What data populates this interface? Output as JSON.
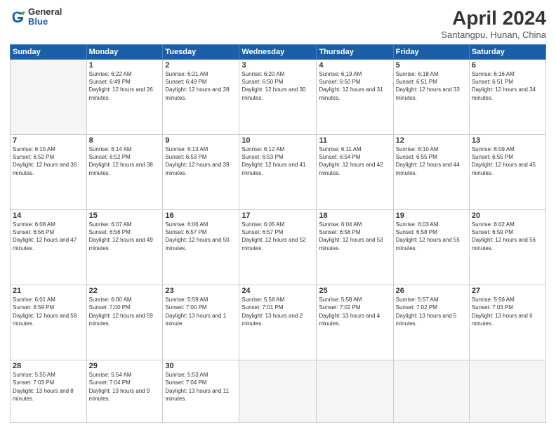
{
  "logo": {
    "general": "General",
    "blue": "Blue"
  },
  "title": "April 2024",
  "location": "Santangpu, Hunan, China",
  "days_of_week": [
    "Sunday",
    "Monday",
    "Tuesday",
    "Wednesday",
    "Thursday",
    "Friday",
    "Saturday"
  ],
  "weeks": [
    [
      {
        "day": "",
        "empty": true
      },
      {
        "day": "1",
        "sunrise": "6:22 AM",
        "sunset": "6:49 PM",
        "daylight": "12 hours and 26 minutes."
      },
      {
        "day": "2",
        "sunrise": "6:21 AM",
        "sunset": "6:49 PM",
        "daylight": "12 hours and 28 minutes."
      },
      {
        "day": "3",
        "sunrise": "6:20 AM",
        "sunset": "6:50 PM",
        "daylight": "12 hours and 30 minutes."
      },
      {
        "day": "4",
        "sunrise": "6:19 AM",
        "sunset": "6:50 PM",
        "daylight": "12 hours and 31 minutes."
      },
      {
        "day": "5",
        "sunrise": "6:18 AM",
        "sunset": "6:51 PM",
        "daylight": "12 hours and 33 minutes."
      },
      {
        "day": "6",
        "sunrise": "6:16 AM",
        "sunset": "6:51 PM",
        "daylight": "12 hours and 34 minutes."
      }
    ],
    [
      {
        "day": "7",
        "sunrise": "6:15 AM",
        "sunset": "6:52 PM",
        "daylight": "12 hours and 36 minutes."
      },
      {
        "day": "8",
        "sunrise": "6:14 AM",
        "sunset": "6:52 PM",
        "daylight": "12 hours and 38 minutes."
      },
      {
        "day": "9",
        "sunrise": "6:13 AM",
        "sunset": "6:53 PM",
        "daylight": "12 hours and 39 minutes."
      },
      {
        "day": "10",
        "sunrise": "6:12 AM",
        "sunset": "6:53 PM",
        "daylight": "12 hours and 41 minutes."
      },
      {
        "day": "11",
        "sunrise": "6:11 AM",
        "sunset": "6:54 PM",
        "daylight": "12 hours and 42 minutes."
      },
      {
        "day": "12",
        "sunrise": "6:10 AM",
        "sunset": "6:55 PM",
        "daylight": "12 hours and 44 minutes."
      },
      {
        "day": "13",
        "sunrise": "6:09 AM",
        "sunset": "6:55 PM",
        "daylight": "12 hours and 45 minutes."
      }
    ],
    [
      {
        "day": "14",
        "sunrise": "6:08 AM",
        "sunset": "6:56 PM",
        "daylight": "12 hours and 47 minutes."
      },
      {
        "day": "15",
        "sunrise": "6:07 AM",
        "sunset": "6:56 PM",
        "daylight": "12 hours and 49 minutes."
      },
      {
        "day": "16",
        "sunrise": "6:06 AM",
        "sunset": "6:57 PM",
        "daylight": "12 hours and 50 minutes."
      },
      {
        "day": "17",
        "sunrise": "6:05 AM",
        "sunset": "6:57 PM",
        "daylight": "12 hours and 52 minutes."
      },
      {
        "day": "18",
        "sunrise": "6:04 AM",
        "sunset": "6:58 PM",
        "daylight": "12 hours and 53 minutes."
      },
      {
        "day": "19",
        "sunrise": "6:03 AM",
        "sunset": "6:58 PM",
        "daylight": "12 hours and 55 minutes."
      },
      {
        "day": "20",
        "sunrise": "6:02 AM",
        "sunset": "6:59 PM",
        "daylight": "12 hours and 56 minutes."
      }
    ],
    [
      {
        "day": "21",
        "sunrise": "6:01 AM",
        "sunset": "6:59 PM",
        "daylight": "12 hours and 58 minutes."
      },
      {
        "day": "22",
        "sunrise": "6:00 AM",
        "sunset": "7:00 PM",
        "daylight": "12 hours and 59 minutes."
      },
      {
        "day": "23",
        "sunrise": "5:59 AM",
        "sunset": "7:00 PM",
        "daylight": "13 hours and 1 minute."
      },
      {
        "day": "24",
        "sunrise": "5:58 AM",
        "sunset": "7:01 PM",
        "daylight": "13 hours and 2 minutes."
      },
      {
        "day": "25",
        "sunrise": "5:58 AM",
        "sunset": "7:02 PM",
        "daylight": "13 hours and 4 minutes."
      },
      {
        "day": "26",
        "sunrise": "5:57 AM",
        "sunset": "7:02 PM",
        "daylight": "13 hours and 5 minutes."
      },
      {
        "day": "27",
        "sunrise": "5:56 AM",
        "sunset": "7:03 PM",
        "daylight": "13 hours and 6 minutes."
      }
    ],
    [
      {
        "day": "28",
        "sunrise": "5:55 AM",
        "sunset": "7:03 PM",
        "daylight": "13 hours and 8 minutes."
      },
      {
        "day": "29",
        "sunrise": "5:54 AM",
        "sunset": "7:04 PM",
        "daylight": "13 hours and 9 minutes."
      },
      {
        "day": "30",
        "sunrise": "5:53 AM",
        "sunset": "7:04 PM",
        "daylight": "13 hours and 11 minutes."
      },
      {
        "day": "",
        "empty": true
      },
      {
        "day": "",
        "empty": true
      },
      {
        "day": "",
        "empty": true
      },
      {
        "day": "",
        "empty": true
      }
    ]
  ]
}
